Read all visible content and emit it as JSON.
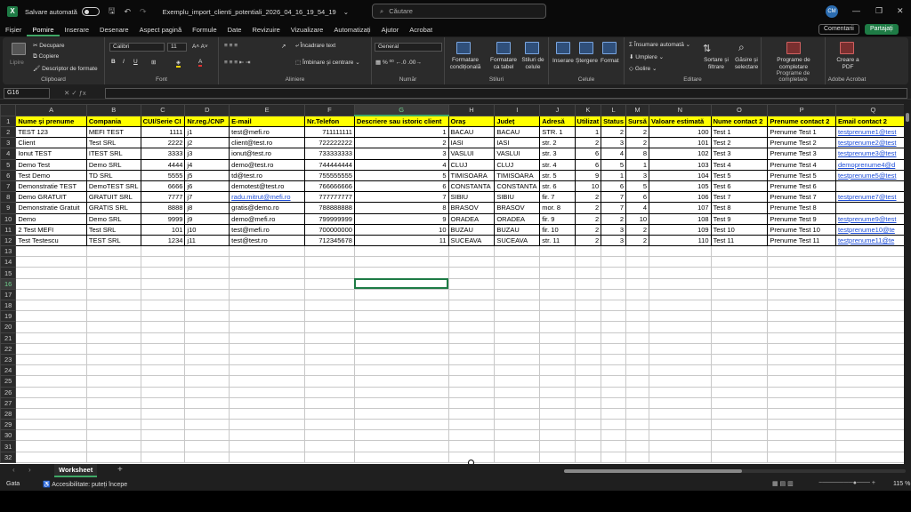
{
  "titlebar": {
    "autosave_label": "Salvare automată",
    "filename": "Exemplu_import_clienti_potentiali_2026_04_16_19_54_19",
    "search_placeholder": "Căutare",
    "avatar_initials": "CM"
  },
  "menu": [
    "Fișier",
    "Pornire",
    "Inserare",
    "Desenare",
    "Aspect pagină",
    "Formule",
    "Date",
    "Revizuire",
    "Vizualizare",
    "Automatizați",
    "Ajutor",
    "Acrobat"
  ],
  "menu_active": "Pornire",
  "menu_buttons": {
    "comments": "Comentarii",
    "share": "Partajați"
  },
  "ribbon": {
    "paste": "Lipire",
    "cut": "Decupare",
    "copy": "Copiere",
    "format_painter": "Descriptor de formate",
    "clipboard": "Clipboard",
    "font_name": "Calibri",
    "font_size": "11",
    "font": "Font",
    "wrap": "Încadrare text",
    "merge": "Îmbinare și centrare",
    "alignment": "Aliniere",
    "number_format": "General",
    "number": "Număr",
    "cond_format": "Formatare condițională",
    "table_format": "Formatare ca tabel",
    "cell_styles": "Stiluri de celule",
    "styles": "Stiluri",
    "insert": "Inserare",
    "delete": "Ștergere",
    "format": "Format",
    "cells": "Celule",
    "autosum": "Însumare automată",
    "fill": "Umplere",
    "clear": "Golire",
    "sort": "Sortare și filtrare",
    "find": "Găsire și selectare",
    "editing": "Editare",
    "addins": "Programe de completare",
    "addins_group": "Programe de completare",
    "create_pdf": "Creare a PDF",
    "acrobat": "Adobe Acrobat"
  },
  "namebox": "G16",
  "columns": [
    "A",
    "B",
    "C",
    "D",
    "E",
    "F",
    "G",
    "H",
    "I",
    "J",
    "K",
    "L",
    "M",
    "N",
    "O",
    "P",
    "Q"
  ],
  "selected_column": "G",
  "selected_row": 16,
  "headers": [
    "Nume și prenume",
    "Compania",
    "CUI/Serie CI",
    "Nr.reg./CNP",
    "E-mail",
    "Nr.Telefon",
    "Descriere sau istoric client",
    "Oraș",
    "Județ",
    "Adresă",
    "Utilizat",
    "Status",
    "Sursă",
    "Valoare estimată",
    "Nume contact 2",
    "Prenume contact 2",
    "Email contact 2"
  ],
  "rows": [
    [
      "TEST 123",
      "MEFI TEST",
      "1111",
      "j1",
      "test@mefi.ro",
      "711111111",
      "1",
      "BACAU",
      "BACAU",
      "STR. 1",
      "1",
      "2",
      "2",
      "100",
      "Test 1",
      "Prenume Test 1",
      "testprenume1@test"
    ],
    [
      "Client",
      "Test SRL",
      "2222",
      "j2",
      "client@test.ro",
      "722222222",
      "2",
      "IASI",
      "IASI",
      "str. 2",
      "2",
      "3",
      "2",
      "101",
      "Test 2",
      "Prenume Test 2",
      "testprenume2@test"
    ],
    [
      "Ionut TEST",
      "ITEST SRL",
      "3333",
      "j3",
      "ionut@test.ro",
      "733333333",
      "3",
      "VASLUI",
      "VASLUI",
      "str. 3",
      "6",
      "4",
      "8",
      "102",
      "Test 3",
      "Prenume Test 3",
      "testprenume3@test"
    ],
    [
      "Demo Test",
      "Demo SRL",
      "4444",
      "j4",
      "demo@test.ro",
      "744444444",
      "4",
      "CLUJ",
      "CLUJ",
      "str. 4",
      "6",
      "5",
      "1",
      "103",
      "Test 4",
      "Prenume Test 4",
      "demoprenume4@d"
    ],
    [
      "Test Demo",
      "TD SRL",
      "5555",
      "j5",
      "td@test.ro",
      "755555555",
      "5",
      "TIMISOARA",
      "TIMISOARA",
      "str. 5",
      "9",
      "1",
      "3",
      "104",
      "Test 5",
      "Prenume Test 5",
      "testprenume5@test"
    ],
    [
      "Demonstratie TEST",
      "DemoTEST SRL",
      "6666",
      "j6",
      "demotest@test.ro",
      "766666666",
      "6",
      "CONSTANTA",
      "CONSTANTA",
      "str. 6",
      "10",
      "6",
      "5",
      "105",
      "Test 6",
      "Prenume Test 6",
      ""
    ],
    [
      "Demo GRATUIT",
      "GRATUIT SRL",
      "7777",
      "j7",
      "radu.mitrut@mefi.ro",
      "777777777",
      "7",
      "SIBIU",
      "SIBIU",
      "fir. 7",
      "2",
      "7",
      "6",
      "106",
      "Test 7",
      "Prenume Test 7",
      "testprenume7@test"
    ],
    [
      "Demonstratie Gratuit",
      "GRATIS SRL",
      "8888",
      "j8",
      "gratis@demo.ro",
      "788888888",
      "8",
      "BRASOV",
      "BRASOV",
      "mor. 8",
      "2",
      "7",
      "4",
      "107",
      "Test 8",
      "Prenume Test 8",
      ""
    ],
    [
      "Demo",
      "Demo SRL",
      "9999",
      "j9",
      "demo@mefi.ro",
      "799999999",
      "9",
      "ORADEA",
      "ORADEA",
      "fir. 9",
      "2",
      "2",
      "10",
      "108",
      "Test 9",
      "Prenume Test 9",
      "testprenume9@test"
    ],
    [
      "2 Test MEFI",
      "Test SRL",
      "101",
      "j10",
      "test@mefi.ro",
      "700000000",
      "10",
      "BUZAU",
      "BUZAU",
      "fir. 10",
      "2",
      "3",
      "2",
      "109",
      "Test 10",
      "Prenume Test 10",
      "testprenume10@te"
    ],
    [
      "Test Testescu",
      "TEST SRL",
      "1234",
      "j11",
      "test@test.ro",
      "712345678",
      "11",
      "SUCEAVA",
      "SUCEAVA",
      "str. 11",
      "2",
      "3",
      "2",
      "110",
      "Test 11",
      "Prenume Test 11",
      "testprenume11@te"
    ]
  ],
  "total_rows": 32,
  "sheet_tab": "Worksheet",
  "status": {
    "ready": "Gata",
    "accessibility": "Accesibilitate: puteți începe",
    "zoom": "115 %"
  }
}
